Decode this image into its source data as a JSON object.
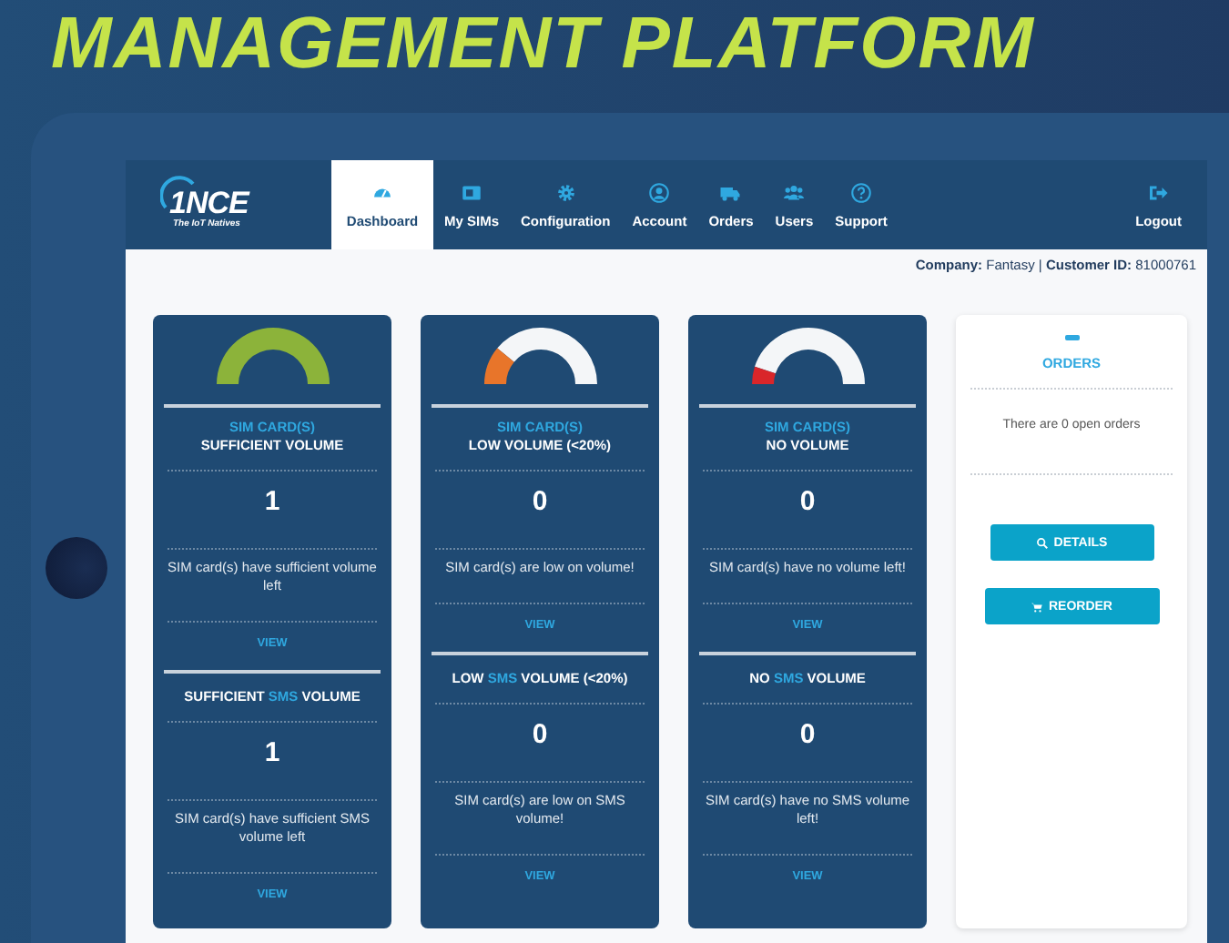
{
  "headline": "MANAGEMENT PLATFORM",
  "logo": {
    "name": "1NCE",
    "tagline": "The IoT Natives"
  },
  "nav": [
    {
      "label": "Dashboard",
      "selected": true
    },
    {
      "label": "My SIMs",
      "selected": false
    },
    {
      "label": "Configuration",
      "selected": false
    },
    {
      "label": "Account",
      "selected": false
    },
    {
      "label": "Orders",
      "selected": false
    },
    {
      "label": "Users",
      "selected": false
    },
    {
      "label": "Support",
      "selected": false
    },
    {
      "label": "Logout",
      "selected": false
    }
  ],
  "company_line": "**Company:** Fantasy | **Customer ID:** 81000761",
  "cards": [
    {
      "gauge": {
        "level": 1,
        "color": "#8cb33a"
      },
      "label": "SIM CARD(S)",
      "title": "SUFFICIENT VOLUME",
      "count": "1",
      "description": "SIM card(s) have sufficient volume left",
      "link": "VIEW",
      "sms": {
        "title_before": "SUFFICIENT ",
        "title_highlight": "SMS",
        "title_after": " VOLUME",
        "count": "1",
        "description": "SIM card(s) have sufficient SMS volume left",
        "link": "VIEW"
      }
    },
    {
      "gauge": {
        "level": 0.22,
        "color": "#e8752a"
      },
      "label": "SIM CARD(S)",
      "title": "LOW VOLUME (<20%)",
      "count": "0",
      "description": "SIM card(s) are low on volume!",
      "link": "VIEW",
      "sms": {
        "title_before": "LOW ",
        "title_highlight": "SMS",
        "title_after": " VOLUME (<20%)",
        "count": "0",
        "description": "SIM card(s) are low on SMS volume!",
        "link": "VIEW"
      }
    },
    {
      "gauge": {
        "level": 0.1,
        "color": "#d9262a"
      },
      "label": "SIM CARD(S)",
      "title": "NO VOLUME",
      "count": "0",
      "description": "SIM card(s) have no volume left!",
      "link": "VIEW",
      "sms": {
        "title_before": "NO ",
        "title_highlight": "SMS",
        "title_after": " VOLUME",
        "count": "0",
        "description": "SIM card(s) have no SMS volume left!",
        "link": "VIEW"
      }
    }
  ],
  "orders": {
    "title": "ORDERS",
    "message": "There are 0 open orders",
    "buttons": [
      "DETAILS",
      "REORDER"
    ]
  }
}
